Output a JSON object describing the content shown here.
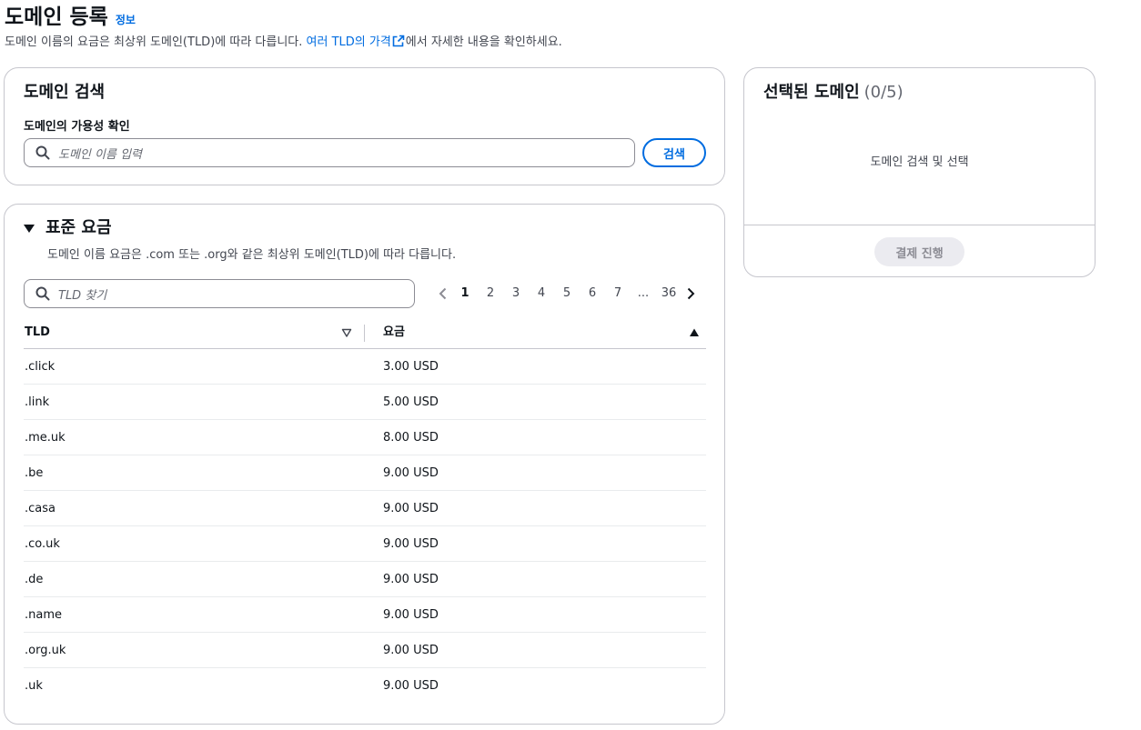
{
  "header": {
    "title": "도메인 등록",
    "info": "정보",
    "desc_before": "도메인 이름의 요금은 최상위 도메인(TLD)에 따라 다릅니다. ",
    "desc_link": "여러 TLD의 가격",
    "desc_after": "에서 자세한 내용을 확인하세요."
  },
  "search": {
    "title": "도메인 검색",
    "label": "도메인의 가용성 확인",
    "placeholder": "도메인 이름 입력",
    "button": "검색"
  },
  "pricing": {
    "title": "표준 요금",
    "desc": "도메인 이름 요금은 .com 또는 .org와 같은 최상위 도메인(TLD)에 따라 다릅니다.",
    "filter_placeholder": "TLD 찾기",
    "pagination": {
      "pages": [
        "1",
        "2",
        "3",
        "4",
        "5",
        "6",
        "7"
      ],
      "current": "1",
      "ellipsis": "...",
      "last": "36"
    },
    "columns": [
      "TLD",
      "요금"
    ],
    "rows": [
      {
        "tld": ".click",
        "price": "3.00 USD"
      },
      {
        "tld": ".link",
        "price": "5.00 USD"
      },
      {
        "tld": ".me.uk",
        "price": "8.00 USD"
      },
      {
        "tld": ".be",
        "price": "9.00 USD"
      },
      {
        "tld": ".casa",
        "price": "9.00 USD"
      },
      {
        "tld": ".co.uk",
        "price": "9.00 USD"
      },
      {
        "tld": ".de",
        "price": "9.00 USD"
      },
      {
        "tld": ".name",
        "price": "9.00 USD"
      },
      {
        "tld": ".org.uk",
        "price": "9.00 USD"
      },
      {
        "tld": ".uk",
        "price": "9.00 USD"
      }
    ]
  },
  "selected": {
    "title": "선택된 도메인",
    "count": "(0/5)",
    "empty": "도메인 검색 및 선택",
    "checkout": "결제 진행"
  },
  "colors": {
    "accent": "#006ce0",
    "border": "#c6c6cd",
    "text": "#0f141a",
    "muted": "#424650",
    "disabled_bg": "#ebebf0"
  }
}
